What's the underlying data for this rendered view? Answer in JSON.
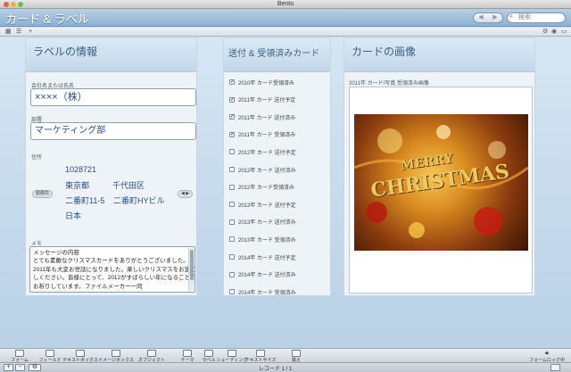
{
  "window": {
    "title": "Bento"
  },
  "header": {
    "title": "カード & ラベル",
    "nav_back": "◀",
    "nav_forward": "▶",
    "search_placeholder": "検索",
    "search_icon": "magnifier-icon"
  },
  "label_panel": {
    "title": "ラベルの情報",
    "company_label": "会社名または氏名",
    "company_value": "××××（株）",
    "dept_label": "部署",
    "dept_value": "マーケティング部",
    "address_label": "住所",
    "postal": "1028721",
    "prefecture": "東京都",
    "city": "千代田区",
    "street": "二番町11-5",
    "building": "二番町HYビル",
    "country": "日本",
    "address_type": "勤務先",
    "address_nav": "◀ ▶",
    "memo_label": "メモ",
    "memo_lines": [
      "メッセージの内容",
      "とても素敵なクリスマスカードをありがとうございました。",
      "2011年も大変お世話になりました。楽しいクリスマスをお過ご",
      "しください。皆様にとって、2012がすばらしい年になることを",
      "お祈りしています。ファイルメーカー一同"
    ]
  },
  "cards_panel": {
    "title": "送付 & 受領済みカード",
    "items": [
      {
        "label": "2010年 カード受領済み",
        "checked": true
      },
      {
        "label": "2011年 カード 送付予定",
        "checked": true
      },
      {
        "label": "2011年 カード 送付済み",
        "checked": true
      },
      {
        "label": "2011年 カード 受領済み",
        "checked": true
      },
      {
        "label": "2012年 カード 送付予定",
        "checked": false
      },
      {
        "label": "2012年 カード 送付済み",
        "checked": false
      },
      {
        "label": "2012年 カード受領済み",
        "checked": false
      },
      {
        "label": "2013年 カード 送付予定",
        "checked": false
      },
      {
        "label": "2013年 カード 送付済み",
        "checked": false
      },
      {
        "label": "2013年 カード 受領済み",
        "checked": false
      },
      {
        "label": "2014年 カード 送付予定",
        "checked": false
      },
      {
        "label": "2014年 カード 送付済み",
        "checked": false
      },
      {
        "label": "2014年 カード 受領済み",
        "checked": false
      }
    ]
  },
  "image_panel": {
    "title": "カードの画像",
    "image_label": "2011年 カード/写真 受領済み画像",
    "image_text_top": "MERRY",
    "image_text_bottom": "CHRISTMAS"
  },
  "bottom_toolbar": {
    "items": [
      "フォーム",
      "フィールド",
      "テキストボックス",
      "イメージボックス",
      "オブジェクト",
      "テーマ",
      "ラベル",
      "シェーディング",
      "テキストサイズ",
      "揃え"
    ],
    "lock": "フォームロック中"
  },
  "statusbar": {
    "record": "レコード 1 / 1",
    "add": "+",
    "remove": "−",
    "gear": "⚙"
  },
  "colors": {
    "accent": "#3a5f86",
    "field_text": "#2a4e86",
    "background": "#c8dcee"
  }
}
